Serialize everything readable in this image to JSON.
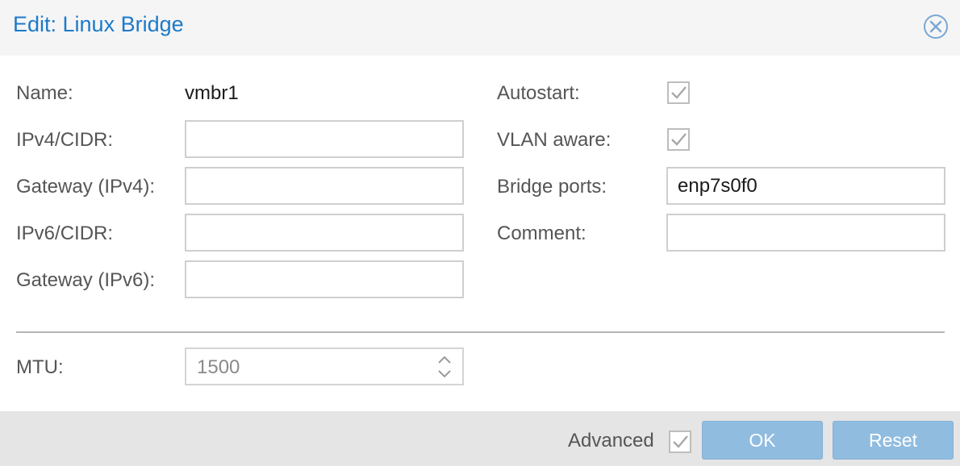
{
  "window": {
    "title": "Edit: Linux Bridge",
    "close_icon": "close-circle-icon"
  },
  "form": {
    "name": {
      "label": "Name:",
      "value": "vmbr1"
    },
    "ipv4": {
      "label": "IPv4/CIDR:",
      "value": ""
    },
    "gateway4": {
      "label": "Gateway (IPv4):",
      "value": ""
    },
    "ipv6": {
      "label": "IPv6/CIDR:",
      "value": ""
    },
    "gateway6": {
      "label": "Gateway (IPv6):",
      "value": ""
    },
    "autostart": {
      "label": "Autostart:",
      "checked": true
    },
    "vlan_aware": {
      "label": "VLAN aware:",
      "checked": true
    },
    "bridge_ports": {
      "label": "Bridge ports:",
      "value": "enp7s0f0"
    },
    "comment": {
      "label": "Comment:",
      "value": ""
    },
    "mtu": {
      "label": "MTU:",
      "value": "1500"
    }
  },
  "footer": {
    "advanced": {
      "label": "Advanced",
      "checked": true
    },
    "ok_label": "OK",
    "reset_label": "Reset"
  },
  "colors": {
    "title": "#1c7ac9",
    "button": "#90bce0",
    "header_bg": "#f5f5f5",
    "footer_bg": "#e5e5e5"
  }
}
